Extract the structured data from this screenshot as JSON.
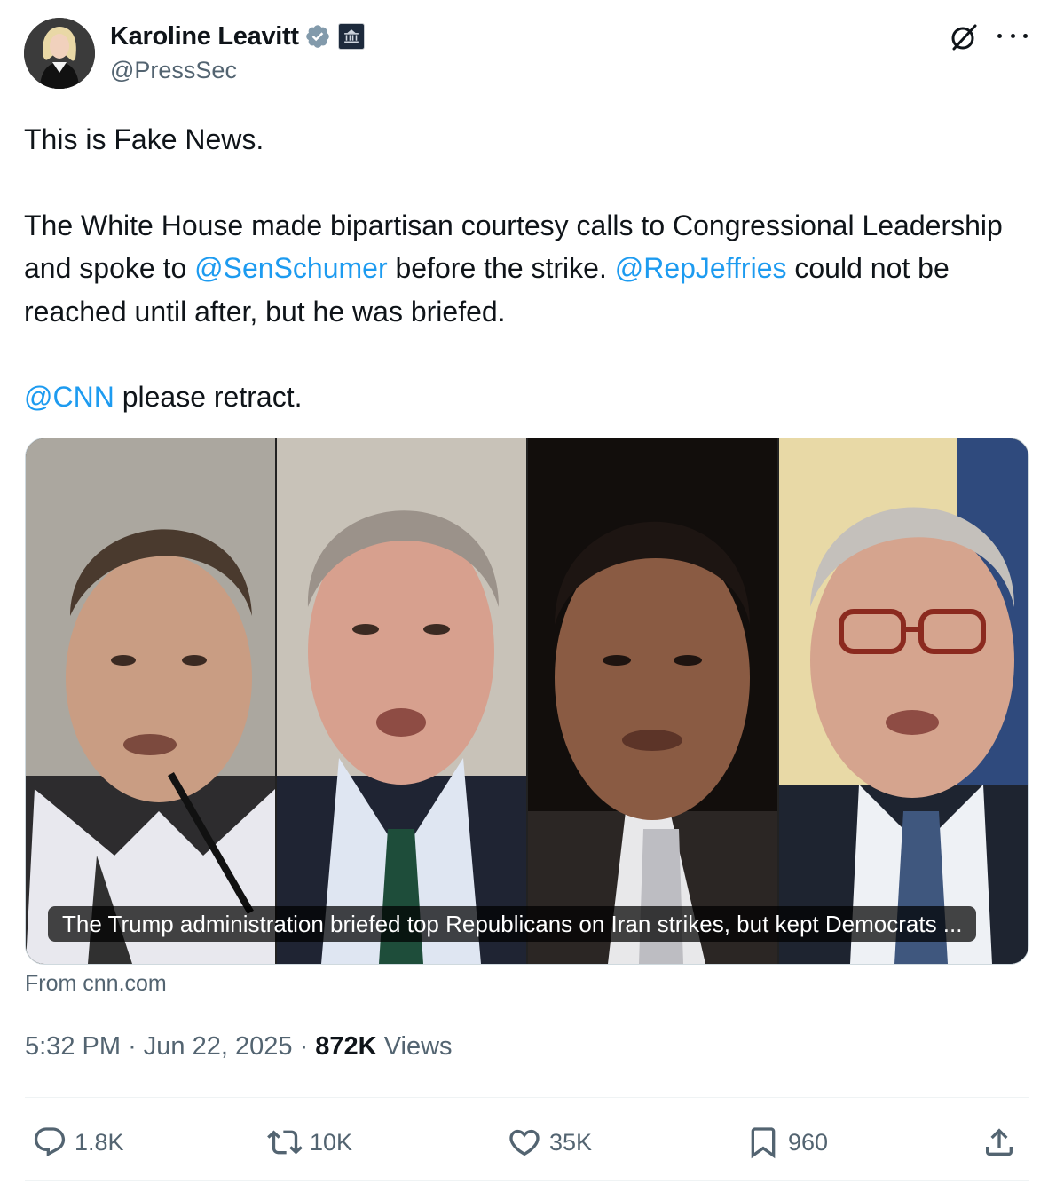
{
  "author": {
    "name": "Karoline Leavitt",
    "handle": "@PressSec",
    "verified_icon": "verified-badge-icon",
    "affiliation_icon": "white-house-seal-icon"
  },
  "tweet": {
    "line1": "This is Fake News.",
    "p2_a": "The White House made bipartisan courtesy calls to Congressional Leadership and spoke to ",
    "mention_schumer": "@SenSchumer",
    "p2_b": " before the strike. ",
    "mention_jeffries": "@RepJeffries",
    "p2_c": " could not be reached until after, but he was briefed.",
    "mention_cnn": "@CNN",
    "p3_b": " please retract."
  },
  "card": {
    "caption": "The Trump administration briefed top Republicans on Iran strikes, but kept Democrats ...",
    "source": "From cnn.com"
  },
  "meta": {
    "time": "5:32 PM",
    "separator": "·",
    "date": "Jun 22, 2025",
    "views_count": "872K",
    "views_label": "Views"
  },
  "actions": {
    "replies": "1.8K",
    "reposts": "10K",
    "likes": "35K",
    "bookmarks": "960"
  },
  "colors": {
    "link": "#1d9bf0",
    "muted": "#536471",
    "text": "#0f1419"
  }
}
